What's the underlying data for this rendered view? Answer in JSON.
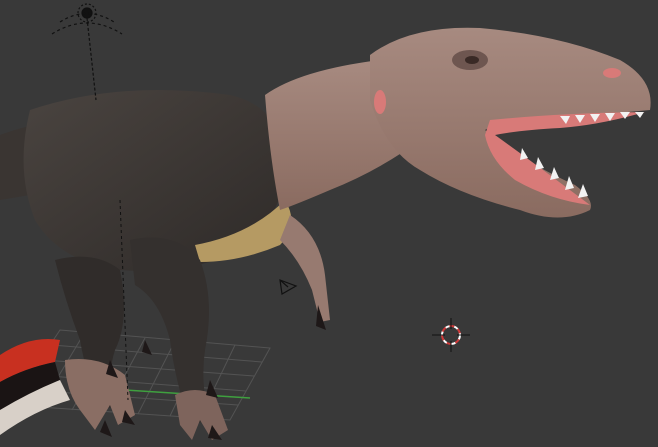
{
  "viewport": {
    "background": "#393939",
    "object": "dinosaur-model",
    "icons": {
      "light": "sun-lamp-icon",
      "camera": "camera-icon",
      "cursor": "3d-cursor-icon"
    },
    "colors": {
      "feathers": "#3d3835",
      "skin": "#9a7a6f",
      "mouth": "#d87a78",
      "teeth": "#f2f2f2",
      "belly": "#b59a63",
      "claws": "#1e1818",
      "cursor_ring": "#d03a3a",
      "grid": "#5a5a5a",
      "axis_y": "#3fa03f"
    }
  }
}
